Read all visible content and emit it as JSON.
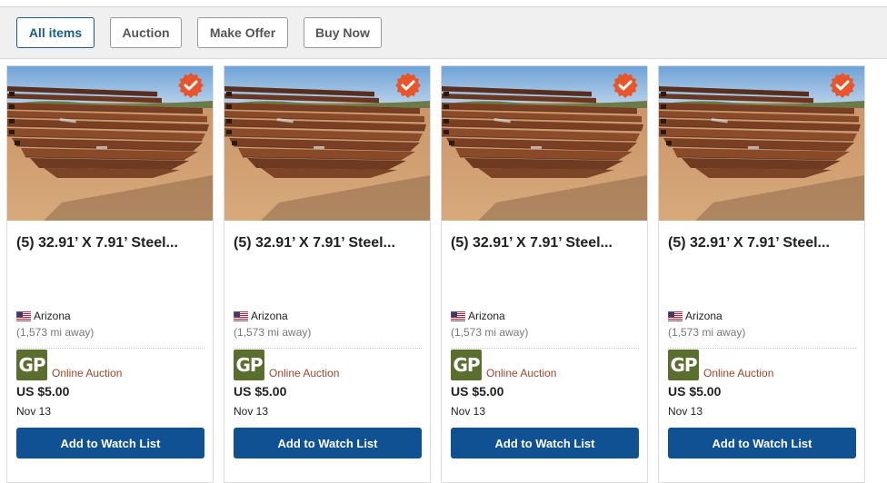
{
  "filters": [
    {
      "label": "All items",
      "active": true
    },
    {
      "label": "Auction",
      "active": false
    },
    {
      "label": "Make Offer",
      "active": false
    },
    {
      "label": "Buy Now",
      "active": false
    }
  ],
  "listings": [
    {
      "title": "(5) 32.91’ X 7.91’ Steel...",
      "location": "Arizona",
      "distance": "(1,573 mi away)",
      "seller_logo": "GP",
      "auction_type": "Online Auction",
      "price": "US $5.00",
      "date": "Nov 13",
      "watch_label": "Add to Watch List"
    },
    {
      "title": "(5) 32.91’ X 7.91’ Steel...",
      "location": "Arizona",
      "distance": "(1,573 mi away)",
      "seller_logo": "GP",
      "auction_type": "Online Auction",
      "price": "US $5.00",
      "date": "Nov 13",
      "watch_label": "Add to Watch List"
    },
    {
      "title": "(5) 32.91’ X 7.91’ Steel...",
      "location": "Arizona",
      "distance": "(1,573 mi away)",
      "seller_logo": "GP",
      "auction_type": "Online Auction",
      "price": "US $5.00",
      "date": "Nov 13",
      "watch_label": "Add to Watch List"
    },
    {
      "title": "(5) 32.91’ X 7.91’ Steel...",
      "location": "Arizona",
      "distance": "(1,573 mi away)",
      "seller_logo": "GP",
      "auction_type": "Online Auction",
      "price": "US $5.00",
      "date": "Nov 13",
      "watch_label": "Add to Watch List"
    }
  ],
  "icons": {
    "verified": "verified-badge-icon",
    "flag": "us-flag-icon"
  },
  "colors": {
    "accent": "#0f5193",
    "auction_type": "#a0452a",
    "verified_badge": "#e8552a",
    "seller_logo_bg": "#5a6e2e"
  }
}
